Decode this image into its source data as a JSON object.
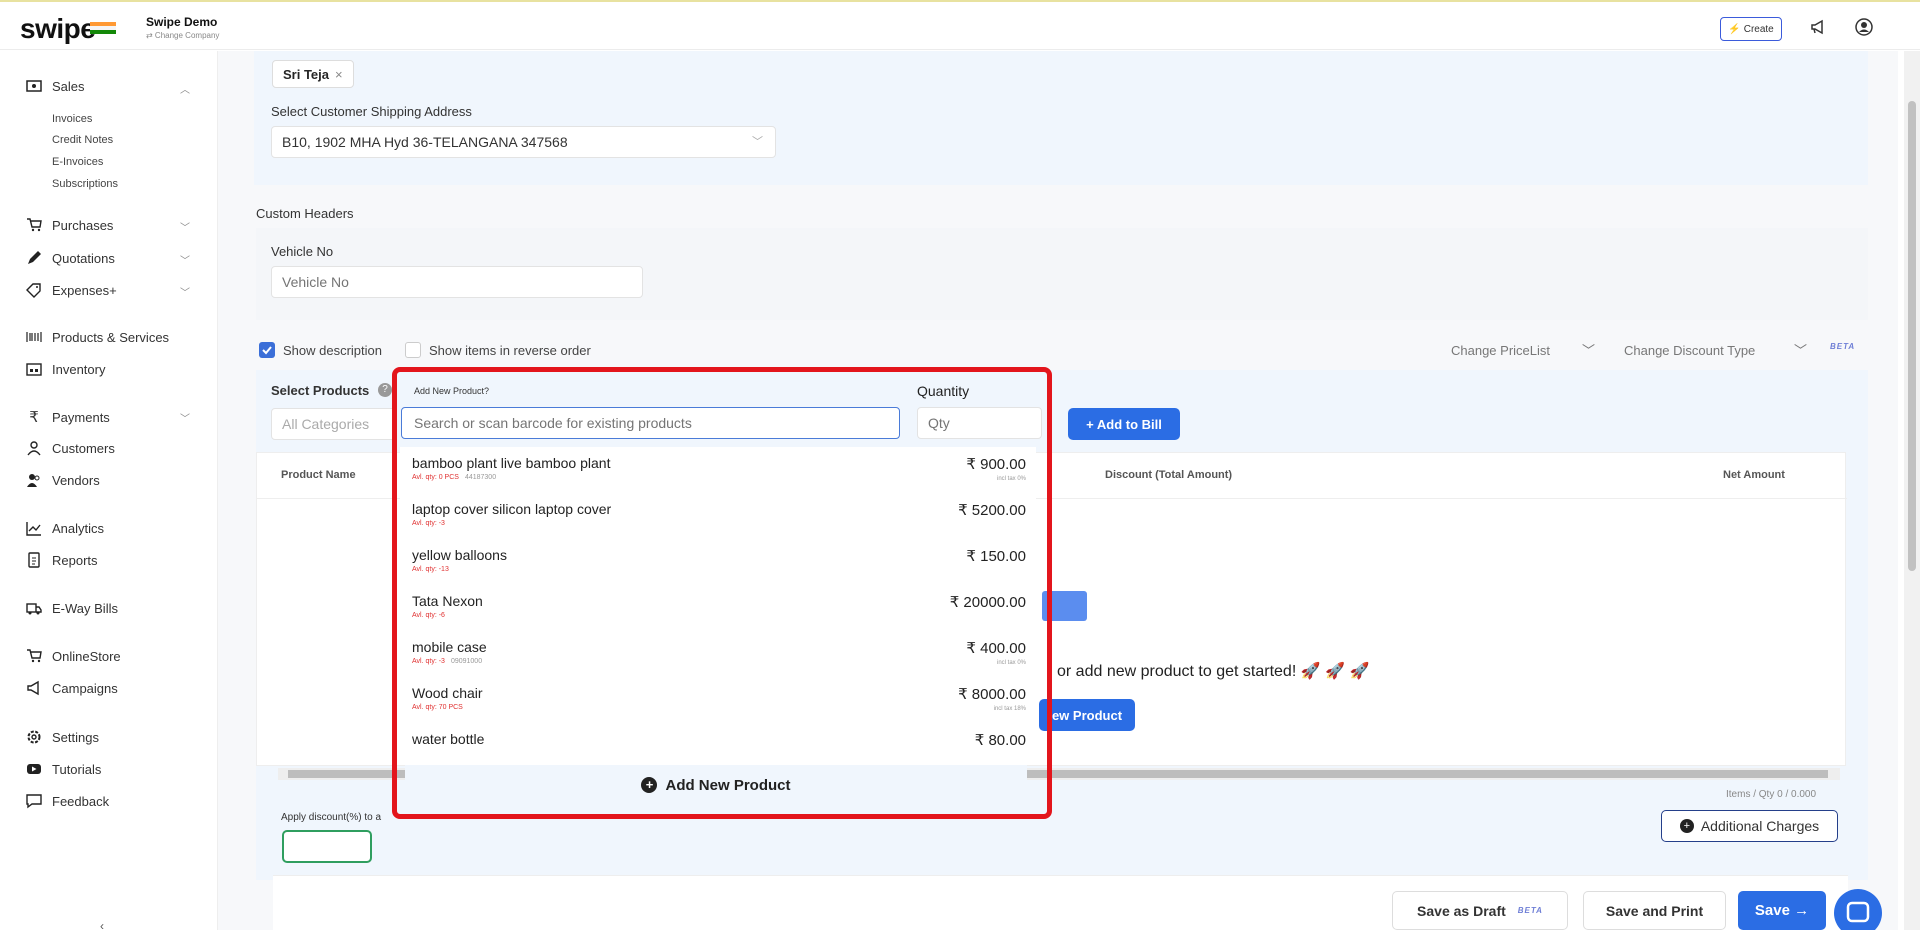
{
  "header": {
    "logo": "swipe",
    "company_name": "Swipe Demo",
    "company_sub": "⇄ Change Company",
    "create_label": "Create",
    "flag_colors": [
      "#ff9933",
      "#ffffff",
      "#138808"
    ]
  },
  "sidebar": {
    "sales": "Sales",
    "sales_items": [
      "Invoices",
      "Credit Notes",
      "E-Invoices",
      "Subscriptions"
    ],
    "purchases": "Purchases",
    "quotations": "Quotations",
    "expenses": "Expenses+",
    "products": "Products & Services",
    "inventory": "Inventory",
    "payments": "Payments",
    "customers": "Customers",
    "vendors": "Vendors",
    "analytics": "Analytics",
    "reports": "Reports",
    "eway": "E-Way Bills",
    "onlinestore": "OnlineStore",
    "campaigns": "Campaigns",
    "settings": "Settings",
    "tutorials": "Tutorials",
    "feedback": "Feedback"
  },
  "form": {
    "customer_chip": "Sri Teja",
    "shipping_label": "Select Customer Shipping Address",
    "shipping_value": "B10, 1902 MHA Hyd 36-TELANGANA 347568",
    "custom_headers": "Custom Headers",
    "vehicle_label": "Vehicle No",
    "vehicle_placeholder": "Vehicle No",
    "show_description": "Show description",
    "reverse_order": "Show items in reverse order",
    "change_pricelist": "Change PriceList",
    "change_discount": "Change Discount Type",
    "beta": "BETA"
  },
  "products": {
    "select_label": "Select Products",
    "categories": "All Categories",
    "add_new_product_q": "Add New Product?",
    "quantity_label": "Quantity",
    "search_placeholder": "Search or scan barcode for existing products",
    "qty_placeholder": "Qty",
    "add_to_bill": "+ Add to Bill",
    "columns": {
      "name": "Product Name",
      "discount": "Discount (Total Amount)",
      "net": "Net Amount"
    },
    "empty_text": "or add new product to get started! 🚀 🚀 🚀",
    "empty_button": "ew Product",
    "items_qty": "Items / Qty 0 / 0.000",
    "apply_discount": "Apply discount(%) to a",
    "additional_charges": "Additional Charges"
  },
  "dropdown": {
    "items": [
      {
        "name": "bamboo plant live bamboo plant",
        "meta": "Avl. qty: 0  PCS",
        "extra": "44187300",
        "price": "₹ 900.00",
        "tax": "incl tax 0%"
      },
      {
        "name": "laptop cover silicon laptop cover",
        "meta": "Avl. qty: -3",
        "extra": "",
        "price": "₹ 5200.00",
        "tax": ""
      },
      {
        "name": "yellow balloons",
        "meta": "Avl. qty: -13",
        "extra": "",
        "price": "₹ 150.00",
        "tax": ""
      },
      {
        "name": "Tata Nexon",
        "meta": "Avl. qty: -6",
        "extra": "",
        "price": "₹ 20000.00",
        "tax": ""
      },
      {
        "name": "mobile case",
        "meta": "Avl. qty: -3",
        "extra": "09091000",
        "price": "₹ 400.00",
        "tax": "incl tax 0%"
      },
      {
        "name": "Wood chair",
        "meta": "Avl. qty: 70  PCS",
        "extra": "",
        "price": "₹ 8000.00",
        "tax": "incl tax 18%"
      },
      {
        "name": "water bottle",
        "meta": "",
        "extra": "",
        "price": "₹ 80.00",
        "tax": ""
      }
    ],
    "add_new": "Add New Product"
  },
  "footer": {
    "save_draft": "Save as Draft",
    "draft_beta": "BETA",
    "save_print": "Save and Print",
    "save": "Save →"
  }
}
